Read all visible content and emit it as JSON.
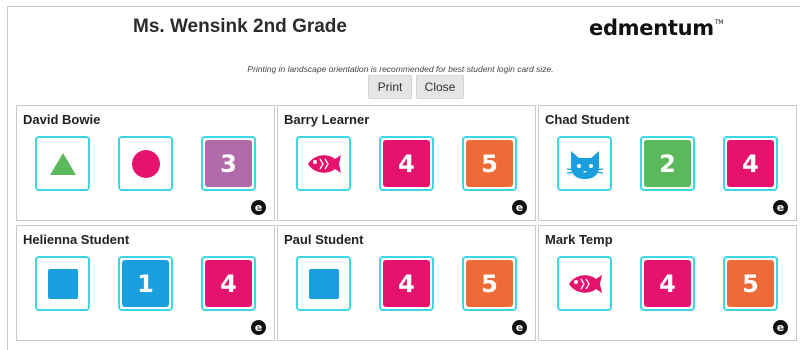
{
  "header": {
    "title": "Ms. Wensink 2nd Grade",
    "logo_text": "edmentum",
    "logo_tm": "TM",
    "notice": "Printing in landscape orientation is recommended for best student login card size."
  },
  "buttons": {
    "print_label": "Print",
    "close_label": "Close"
  },
  "colors": {
    "tile_border": "#3ed6e4",
    "green": "#5bb85c",
    "pink": "#e5136e",
    "purple": "#b36aab",
    "orange": "#ee6a36",
    "blue": "#1a9fde"
  },
  "cards": [
    {
      "name": "David Bowie",
      "tiles": [
        {
          "icon": "triangle-icon"
        },
        {
          "icon": "circle-icon"
        },
        {
          "number": "3",
          "color": "purple"
        }
      ]
    },
    {
      "name": "Barry Learner",
      "tiles": [
        {
          "icon": "fish-icon"
        },
        {
          "number": "4",
          "color": "pink"
        },
        {
          "number": "5",
          "color": "orange"
        }
      ]
    },
    {
      "name": "Chad Student",
      "tiles": [
        {
          "icon": "cat-icon"
        },
        {
          "number": "2",
          "color": "green"
        },
        {
          "number": "4",
          "color": "pink"
        }
      ]
    },
    {
      "name": "Helienna Student",
      "tiles": [
        {
          "icon": "square-icon"
        },
        {
          "number": "1",
          "color": "blue"
        },
        {
          "number": "4",
          "color": "pink"
        }
      ]
    },
    {
      "name": "Paul Student",
      "tiles": [
        {
          "icon": "square-icon"
        },
        {
          "number": "4",
          "color": "pink"
        },
        {
          "number": "5",
          "color": "orange"
        }
      ]
    },
    {
      "name": "Mark Temp",
      "tiles": [
        {
          "icon": "fish-icon"
        },
        {
          "number": "4",
          "color": "pink"
        },
        {
          "number": "5",
          "color": "orange"
        }
      ]
    }
  ],
  "card_mark": "e"
}
